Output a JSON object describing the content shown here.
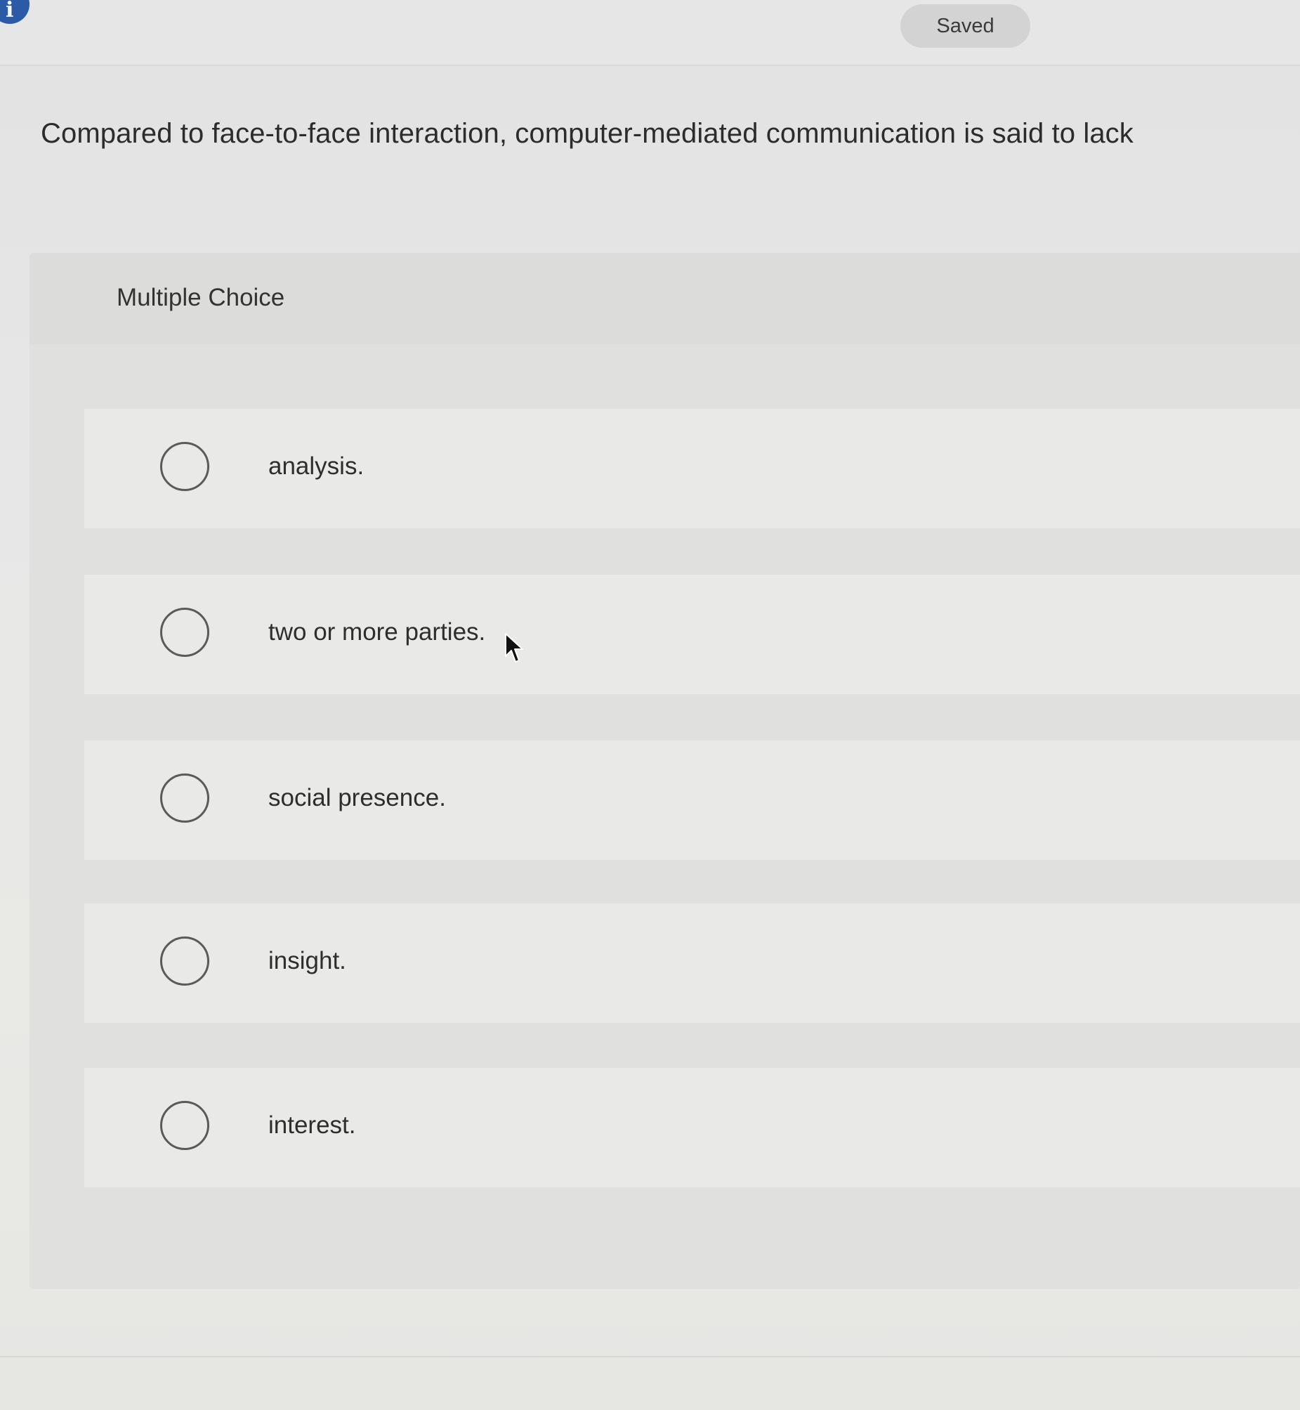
{
  "header": {
    "info_icon_glyph": "i",
    "status_badge": "Saved"
  },
  "question": {
    "text": "Compared to face-to-face interaction, computer-mediated communication is said to lack"
  },
  "multiple_choice": {
    "label": "Multiple Choice",
    "options": [
      {
        "label": "analysis.",
        "selected": false
      },
      {
        "label": "two or more parties.",
        "selected": false
      },
      {
        "label": "social presence.",
        "selected": false
      },
      {
        "label": "insight.",
        "selected": false
      },
      {
        "label": "interest.",
        "selected": false
      }
    ]
  },
  "colors": {
    "info_icon": "#2b5aa6",
    "badge_bg": "#d3d3d3",
    "option_bg": "#e9e9e7",
    "card_bg": "#e0e0df"
  },
  "icons": {
    "info": "info-icon",
    "radio": "radio-icon",
    "cursor": "mouse-cursor-icon"
  }
}
